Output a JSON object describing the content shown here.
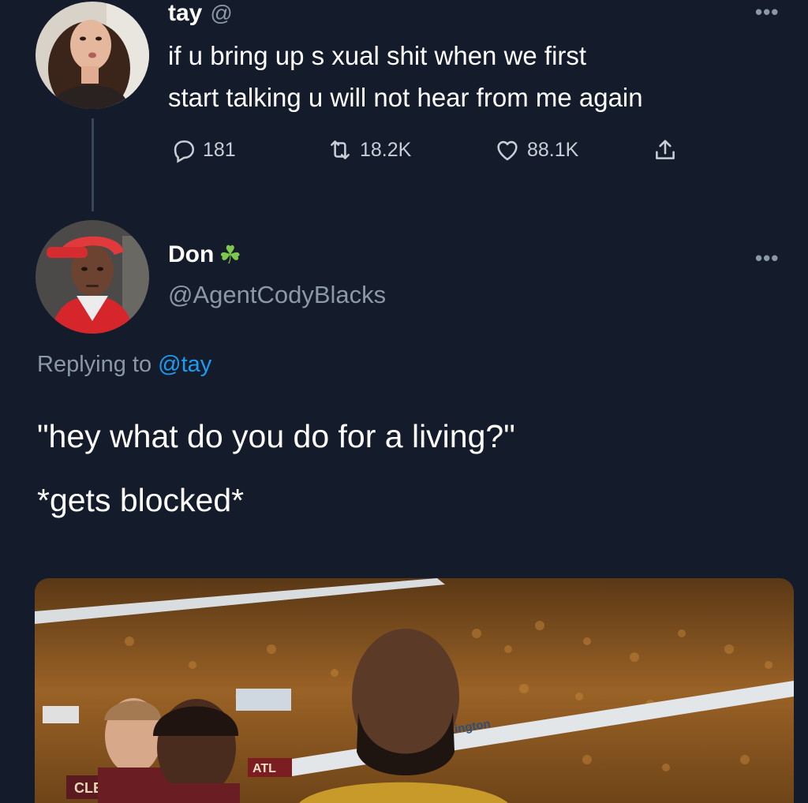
{
  "original_tweet": {
    "name": "tay",
    "handle_suffix": "@",
    "text_line1": "if u bring up s  xual shit when we first",
    "text_line2": "start talking u will not hear from me again",
    "replies": "181",
    "retweets": "18.2K",
    "likes": "88.1K"
  },
  "reply_tweet": {
    "name": "Don",
    "badge_emoji": "☘",
    "handle": "@AgentCodyBlacks",
    "replying_prefix": "Replying to ",
    "replying_handle": "@tay",
    "text_line1": "\"hey what do you do for a living?\"",
    "text_line2": "*gets blocked*"
  },
  "media": {
    "banner_text_1": "tington",
    "scoreboard_text_1": "CLE",
    "scoreboard_text_2": "ATL"
  },
  "more_glyph": "•••",
  "colors": {
    "background": "#141b2b",
    "link": "#1d9bf0",
    "muted": "#8b98a5"
  }
}
